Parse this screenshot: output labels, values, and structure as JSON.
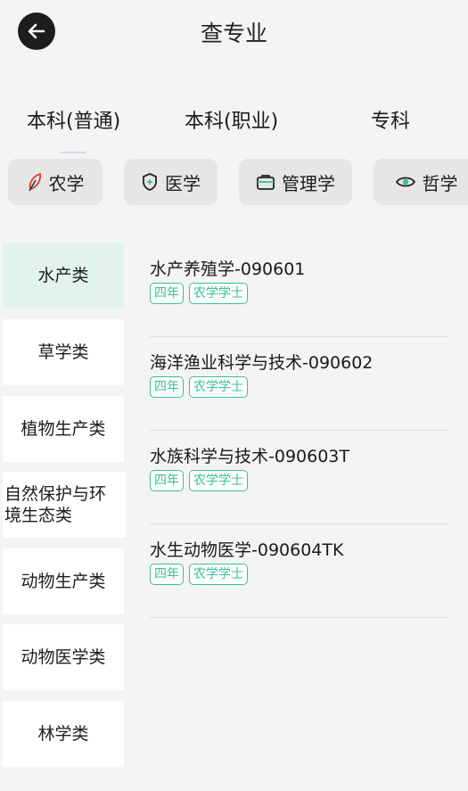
{
  "header": {
    "title": "查专业",
    "back_icon": "arrow-left-icon"
  },
  "degree_tabs": [
    {
      "label": "本科(普通)"
    },
    {
      "label": "本科(职业)"
    },
    {
      "label": "专科"
    }
  ],
  "categories": [
    {
      "label": "农学",
      "icon": "leaf-icon"
    },
    {
      "label": "医学",
      "icon": "shield-plus-icon"
    },
    {
      "label": "管理学",
      "icon": "briefcase-icon"
    },
    {
      "label": "哲学",
      "icon": "eye-icon"
    }
  ],
  "sidebar": {
    "items": [
      {
        "label": "水产类"
      },
      {
        "label": "草学类"
      },
      {
        "label": "植物生产类"
      },
      {
        "label": "自然保护与环境生态类"
      },
      {
        "label": "动物生产类"
      },
      {
        "label": "动物医学类"
      },
      {
        "label": "林学类"
      }
    ]
  },
  "majors": [
    {
      "name": "水产养殖学-090601",
      "duration": "四年",
      "degree": "农学学士"
    },
    {
      "name": "海洋渔业科学与技术-090602",
      "duration": "四年",
      "degree": "农学学士"
    },
    {
      "name": "水族科学与技术-090603T",
      "duration": "四年",
      "degree": "农学学士"
    },
    {
      "name": "水生动物医学-090604TK",
      "duration": "四年",
      "degree": "农学学士"
    }
  ],
  "colors": {
    "accent": "#3cbf9a",
    "active_side_bg": "#e2f3ee",
    "leaf_icon": "#e53935"
  }
}
